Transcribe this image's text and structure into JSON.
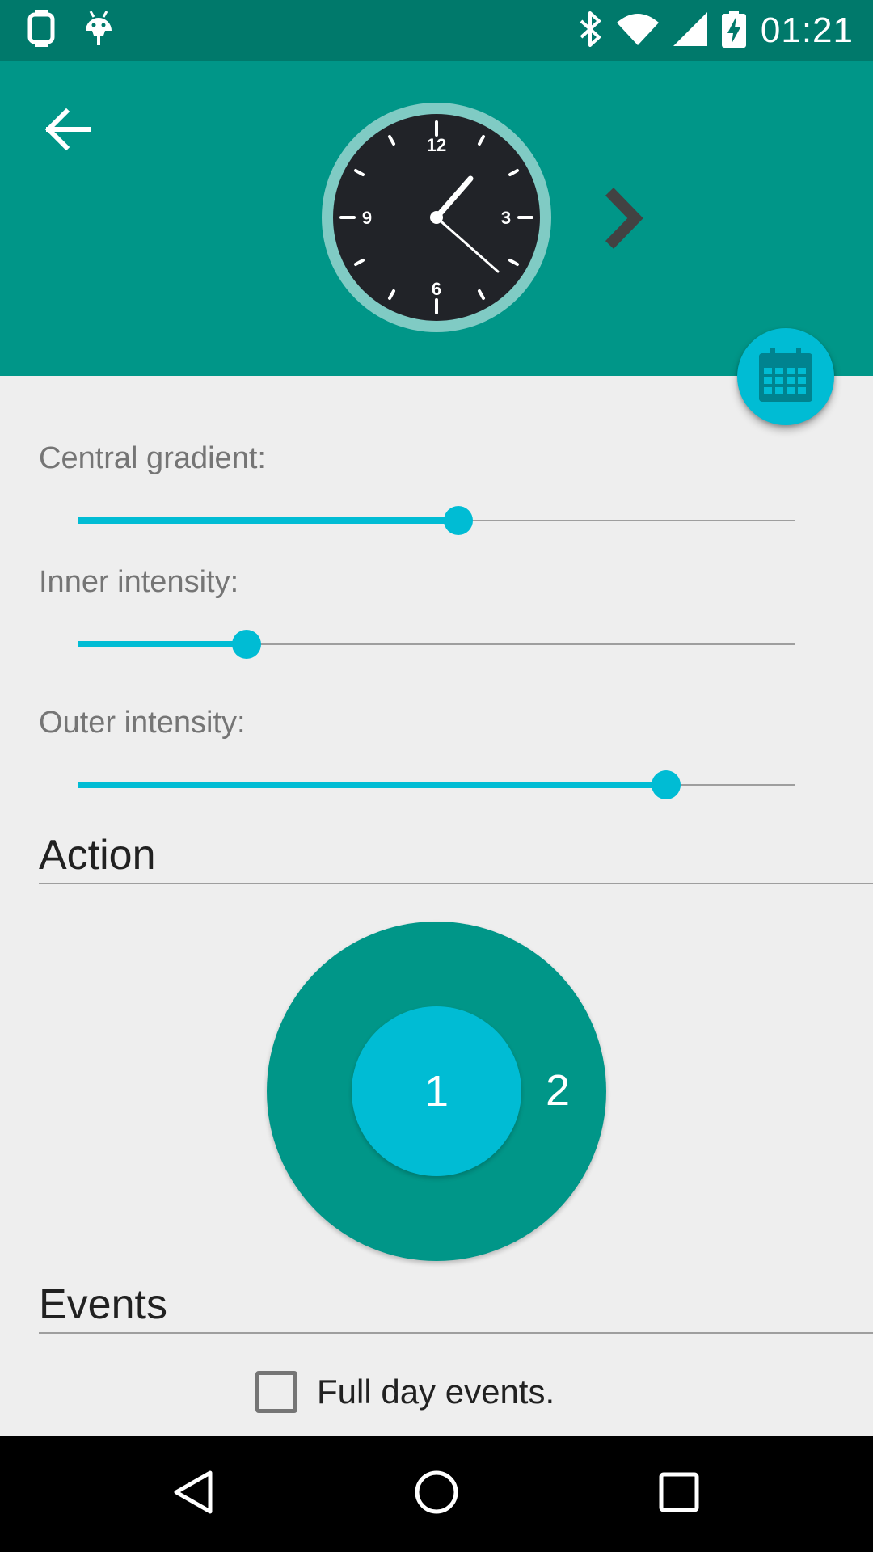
{
  "status_bar": {
    "time": "01:21",
    "left_icons": [
      "watch-icon",
      "android-icon"
    ],
    "right_icons": [
      "bluetooth-icon",
      "wifi-icon",
      "signal-icon",
      "battery-charging-icon"
    ]
  },
  "header": {
    "back_icon": "arrow-back-icon",
    "next_icon": "chevron-right-icon",
    "watch_numbers": [
      "12",
      "3",
      "6",
      "9"
    ],
    "fab_icon": "calendar-icon"
  },
  "sliders": [
    {
      "label": "Central gradient:",
      "value": 0.53
    },
    {
      "label": "Inner intensity:",
      "value": 0.235
    },
    {
      "label": "Outer intensity:",
      "value": 0.82
    }
  ],
  "action": {
    "title": "Action",
    "inner_label": "1",
    "outer_label": "2"
  },
  "events": {
    "title": "Events",
    "full_day_label": "Full day events.",
    "full_day_checked": false
  },
  "nav": {
    "icons": [
      "back-triangle-icon",
      "home-circle-icon",
      "recents-square-icon"
    ]
  },
  "colors": {
    "status_bar": "#00796b",
    "primary": "#009688",
    "accent": "#00bcd4"
  }
}
